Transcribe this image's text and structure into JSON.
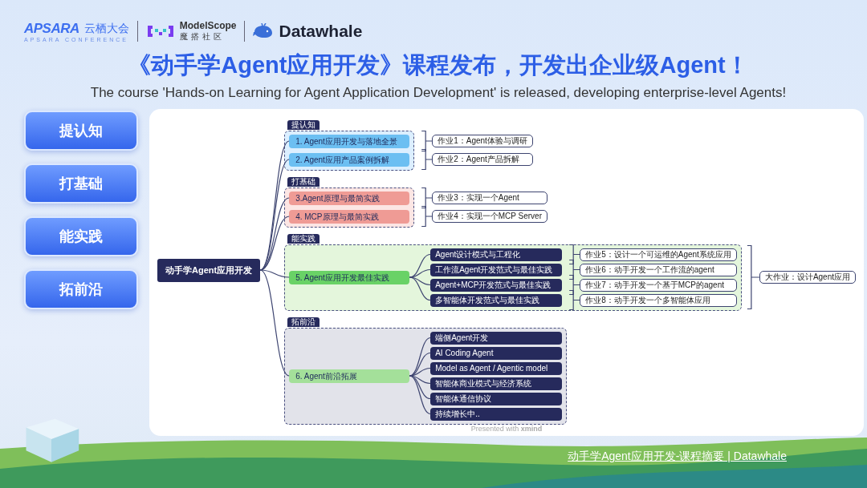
{
  "header": {
    "apsara": {
      "wordmark": "APSARA",
      "name": "云栖大会",
      "tagline": "APSARA CONFERENCE"
    },
    "modelscope": {
      "wordmark": "ModelScope",
      "name": "魔搭社区"
    },
    "datawhale": {
      "wordmark": "Datawhale"
    }
  },
  "title": "《动手学Agent应用开发》课程发布，开发出企业级Agent！",
  "subtitle": "The course 'Hands-on Learning for Agent Application Development' is released, developing enterprise-level Agents!",
  "stages": [
    "提认知",
    "打基础",
    "能实践",
    "拓前沿"
  ],
  "mindmap": {
    "root": "动手学Agent应用开发",
    "sections": [
      {
        "label": "提认知",
        "kind": "blue",
        "topics": [
          {
            "title": "1. Agent应用开发与落地全景",
            "homework": "作业1：Agent体验与调研"
          },
          {
            "title": "2. Agent应用产品案例拆解",
            "homework": "作业2：Agent产品拆解"
          }
        ]
      },
      {
        "label": "打基础",
        "kind": "red",
        "topics": [
          {
            "title": "3.Agent原理与最简实践",
            "homework": "作业3：实现一个Agent"
          },
          {
            "title": "4.  MCP原理与最简实践",
            "homework": "作业4：实现一个MCP Server"
          }
        ]
      },
      {
        "label": "能实践",
        "kind": "green",
        "final": "大作业：设计Agent应用",
        "topics": [
          {
            "title": "5. Agent应用开发最佳实践",
            "subtopics": [
              {
                "title": "Agent设计模式与工程化",
                "homework": "作业5：设计一个可运维的Agent系统应用"
              },
              {
                "title": "工作流Agent开发范式与最佳实践",
                "homework": "作业6：动手开发一个工作流的agent"
              },
              {
                "title": "Agent+MCP开发范式与最佳实践",
                "homework": "作业7：动手开发一个基于MCP的agent"
              },
              {
                "title": "多智能体开发范式与最佳实践",
                "homework": "作业8：动手开发一个多智能体应用"
              }
            ]
          }
        ]
      },
      {
        "label": "拓前沿",
        "kind": "gray",
        "topics": [
          {
            "title": "6. Agent前沿拓展",
            "subtopics": [
              {
                "title": "端侧Agent开发"
              },
              {
                "title": "AI Coding Agent"
              },
              {
                "title": "Model as Agent / Agentic model"
              },
              {
                "title": "智能体商业模式与经济系统"
              },
              {
                "title": "智能体通信协议"
              },
              {
                "title": "持续增长中.."
              }
            ]
          }
        ]
      }
    ],
    "credit": "Presented with **xmind**"
  },
  "footer_link": "动手学Agent应用开发-课程摘要 | Datawhale"
}
